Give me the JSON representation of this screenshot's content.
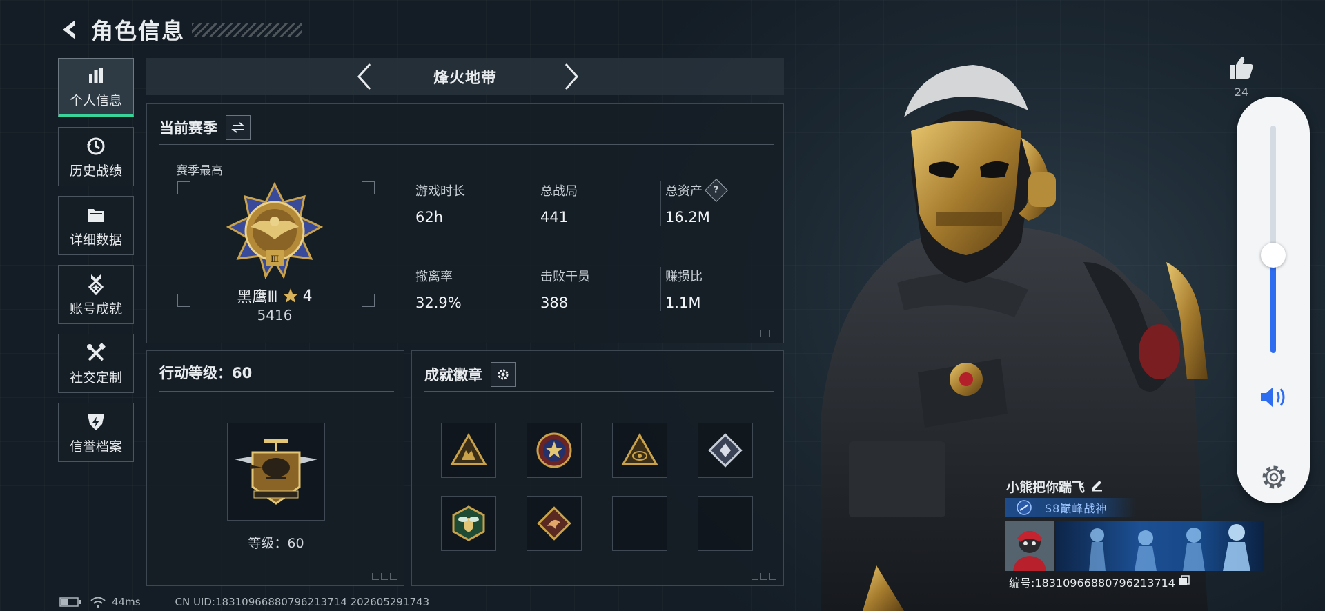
{
  "page": {
    "title": "角色信息"
  },
  "sidenav": {
    "items": [
      {
        "label": "个人信息",
        "icon": "bar-chart-icon",
        "active": true
      },
      {
        "label": "历史战绩",
        "icon": "history-clock-icon",
        "active": false
      },
      {
        "label": "详细数据",
        "icon": "folder-icon",
        "active": false
      },
      {
        "label": "账号成就",
        "icon": "achievement-medal-icon",
        "active": false
      },
      {
        "label": "社交定制",
        "icon": "tools-icon",
        "active": false
      },
      {
        "label": "信誉档案",
        "icon": "shield-bolt-icon",
        "active": false
      }
    ]
  },
  "mode": {
    "title": "烽火地带"
  },
  "season": {
    "title": "当前赛季",
    "subtitle": "赛季最高",
    "rank_name": "黑鹰Ⅲ",
    "rank_stars": "4",
    "rank_score": "5416",
    "stats": [
      {
        "label": "游戏时长",
        "value": "62h"
      },
      {
        "label": "总战局",
        "value": "441"
      },
      {
        "label": "总资产",
        "value": "16.2M",
        "help": "?"
      },
      {
        "label": "撤离率",
        "value": "32.9%"
      },
      {
        "label": "击败干员",
        "value": "388"
      },
      {
        "label": "赚损比",
        "value": "1.1M"
      }
    ]
  },
  "action_level": {
    "title": "行动等级：60",
    "caption": "等级：60"
  },
  "badges": {
    "title": "成就徽章",
    "slots": [
      {
        "icon": "hands-triangle-badge-icon",
        "empty": false
      },
      {
        "icon": "star-circle-badge-icon",
        "empty": false
      },
      {
        "icon": "eye-triangle-badge-icon",
        "empty": false
      },
      {
        "icon": "crystal-diamond-badge-icon",
        "empty": false
      },
      {
        "icon": "bee-hexagon-badge-icon",
        "empty": false
      },
      {
        "icon": "dragon-diamond-badge-icon",
        "empty": false
      },
      {
        "icon": "",
        "empty": true
      },
      {
        "icon": "",
        "empty": true
      }
    ]
  },
  "like": {
    "count": "24"
  },
  "volume": {
    "level": 0.43
  },
  "player": {
    "name": "小熊把你踹飞",
    "title_badge": "S8巅峰战神",
    "id_text": "编号:18310966880796213714"
  },
  "footer": {
    "ping": "44ms",
    "uid": "CN UID:18310966880796213714 202605291743"
  },
  "colors": {
    "accent_green": "#39d49a",
    "volume_blue": "#2f6df0",
    "gold": "#c9a24a"
  }
}
